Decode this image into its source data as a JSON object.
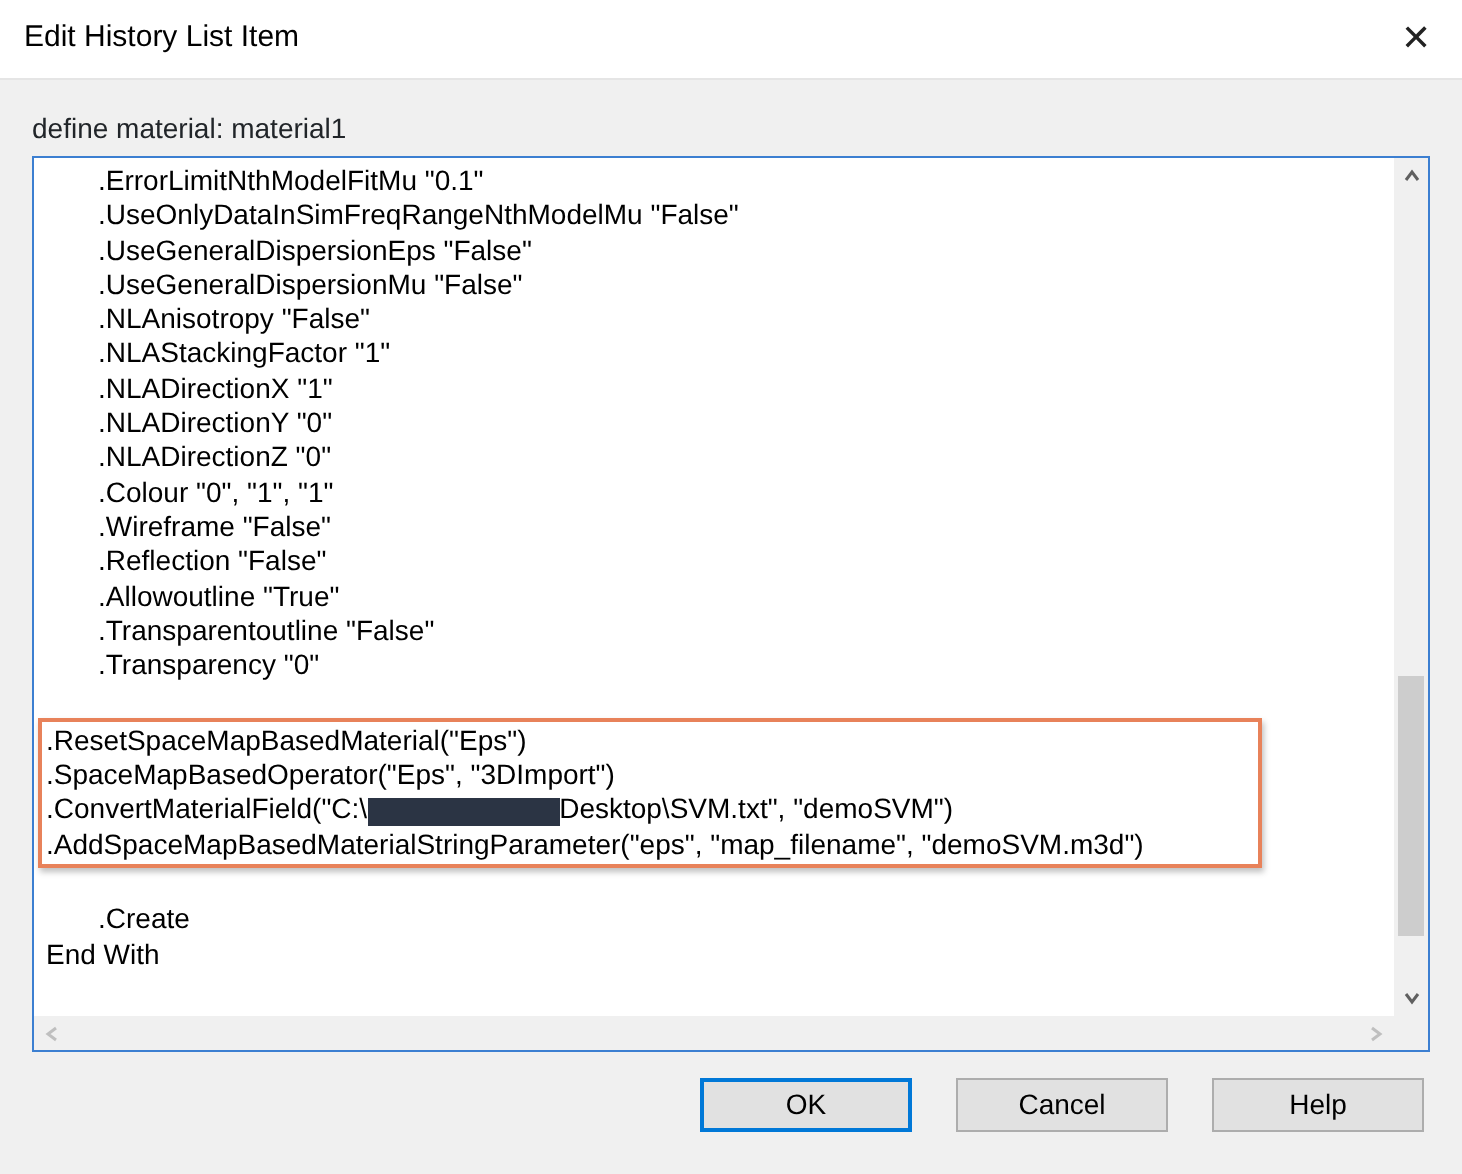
{
  "window": {
    "title": "Edit History List Item",
    "close": "✕"
  },
  "label": "define material: material1",
  "code_blocks": [
    {
      "highlighted": false,
      "lines": [
        {
          "kind": "text",
          "indented": true,
          "text": ".ErrorLimitNthModelFitMu \"0.1\""
        },
        {
          "kind": "text",
          "indented": true,
          "text": ".UseOnlyDataInSimFreqRangeNthModelMu \"False\""
        },
        {
          "kind": "text",
          "indented": true,
          "text": ".UseGeneralDispersionEps \"False\""
        },
        {
          "kind": "text",
          "indented": true,
          "text": ".UseGeneralDispersionMu \"False\""
        },
        {
          "kind": "text",
          "indented": true,
          "text": ".NLAnisotropy \"False\""
        },
        {
          "kind": "text",
          "indented": true,
          "text": ".NLAStackingFactor \"1\""
        },
        {
          "kind": "text",
          "indented": true,
          "text": ".NLADirectionX \"1\""
        },
        {
          "kind": "text",
          "indented": true,
          "text": ".NLADirectionY \"0\""
        },
        {
          "kind": "text",
          "indented": true,
          "text": ".NLADirectionZ \"0\""
        },
        {
          "kind": "text",
          "indented": true,
          "text": ".Colour \"0\", \"1\", \"1\""
        },
        {
          "kind": "text",
          "indented": true,
          "text": ".Wireframe \"False\""
        },
        {
          "kind": "text",
          "indented": true,
          "text": ".Reflection \"False\""
        },
        {
          "kind": "text",
          "indented": true,
          "text": ".Allowoutline \"True\""
        },
        {
          "kind": "text",
          "indented": true,
          "text": ".Transparentoutline \"False\""
        },
        {
          "kind": "text",
          "indented": true,
          "text": ".Transparency \"0\""
        }
      ]
    },
    {
      "highlighted": true,
      "lines": [
        {
          "kind": "text",
          "indented": false,
          "text": ".ResetSpaceMapBasedMaterial(\"Eps\")"
        },
        {
          "kind": "text",
          "indented": false,
          "text": ".SpaceMapBasedOperator(\"Eps\", \"3DImport\")"
        },
        {
          "kind": "redacted",
          "before": ".ConvertMaterialField(\"C:\\",
          "after": "Desktop\\SVM.txt\", \"demoSVM\")"
        },
        {
          "kind": "text",
          "indented": false,
          "text": ".AddSpaceMapBasedMaterialStringParameter(\"eps\", \"map_filename\", \"demoSVM.m3d\")"
        }
      ]
    },
    {
      "highlighted": false,
      "lines": [
        {
          "kind": "text",
          "indented": true,
          "text": ".Create"
        },
        {
          "kind": "text",
          "indented": false,
          "text": "End With"
        }
      ]
    }
  ],
  "buttons": [
    {
      "label": "OK",
      "default": true
    },
    {
      "label": "Cancel",
      "default": false
    },
    {
      "label": "Help",
      "default": false
    }
  ]
}
